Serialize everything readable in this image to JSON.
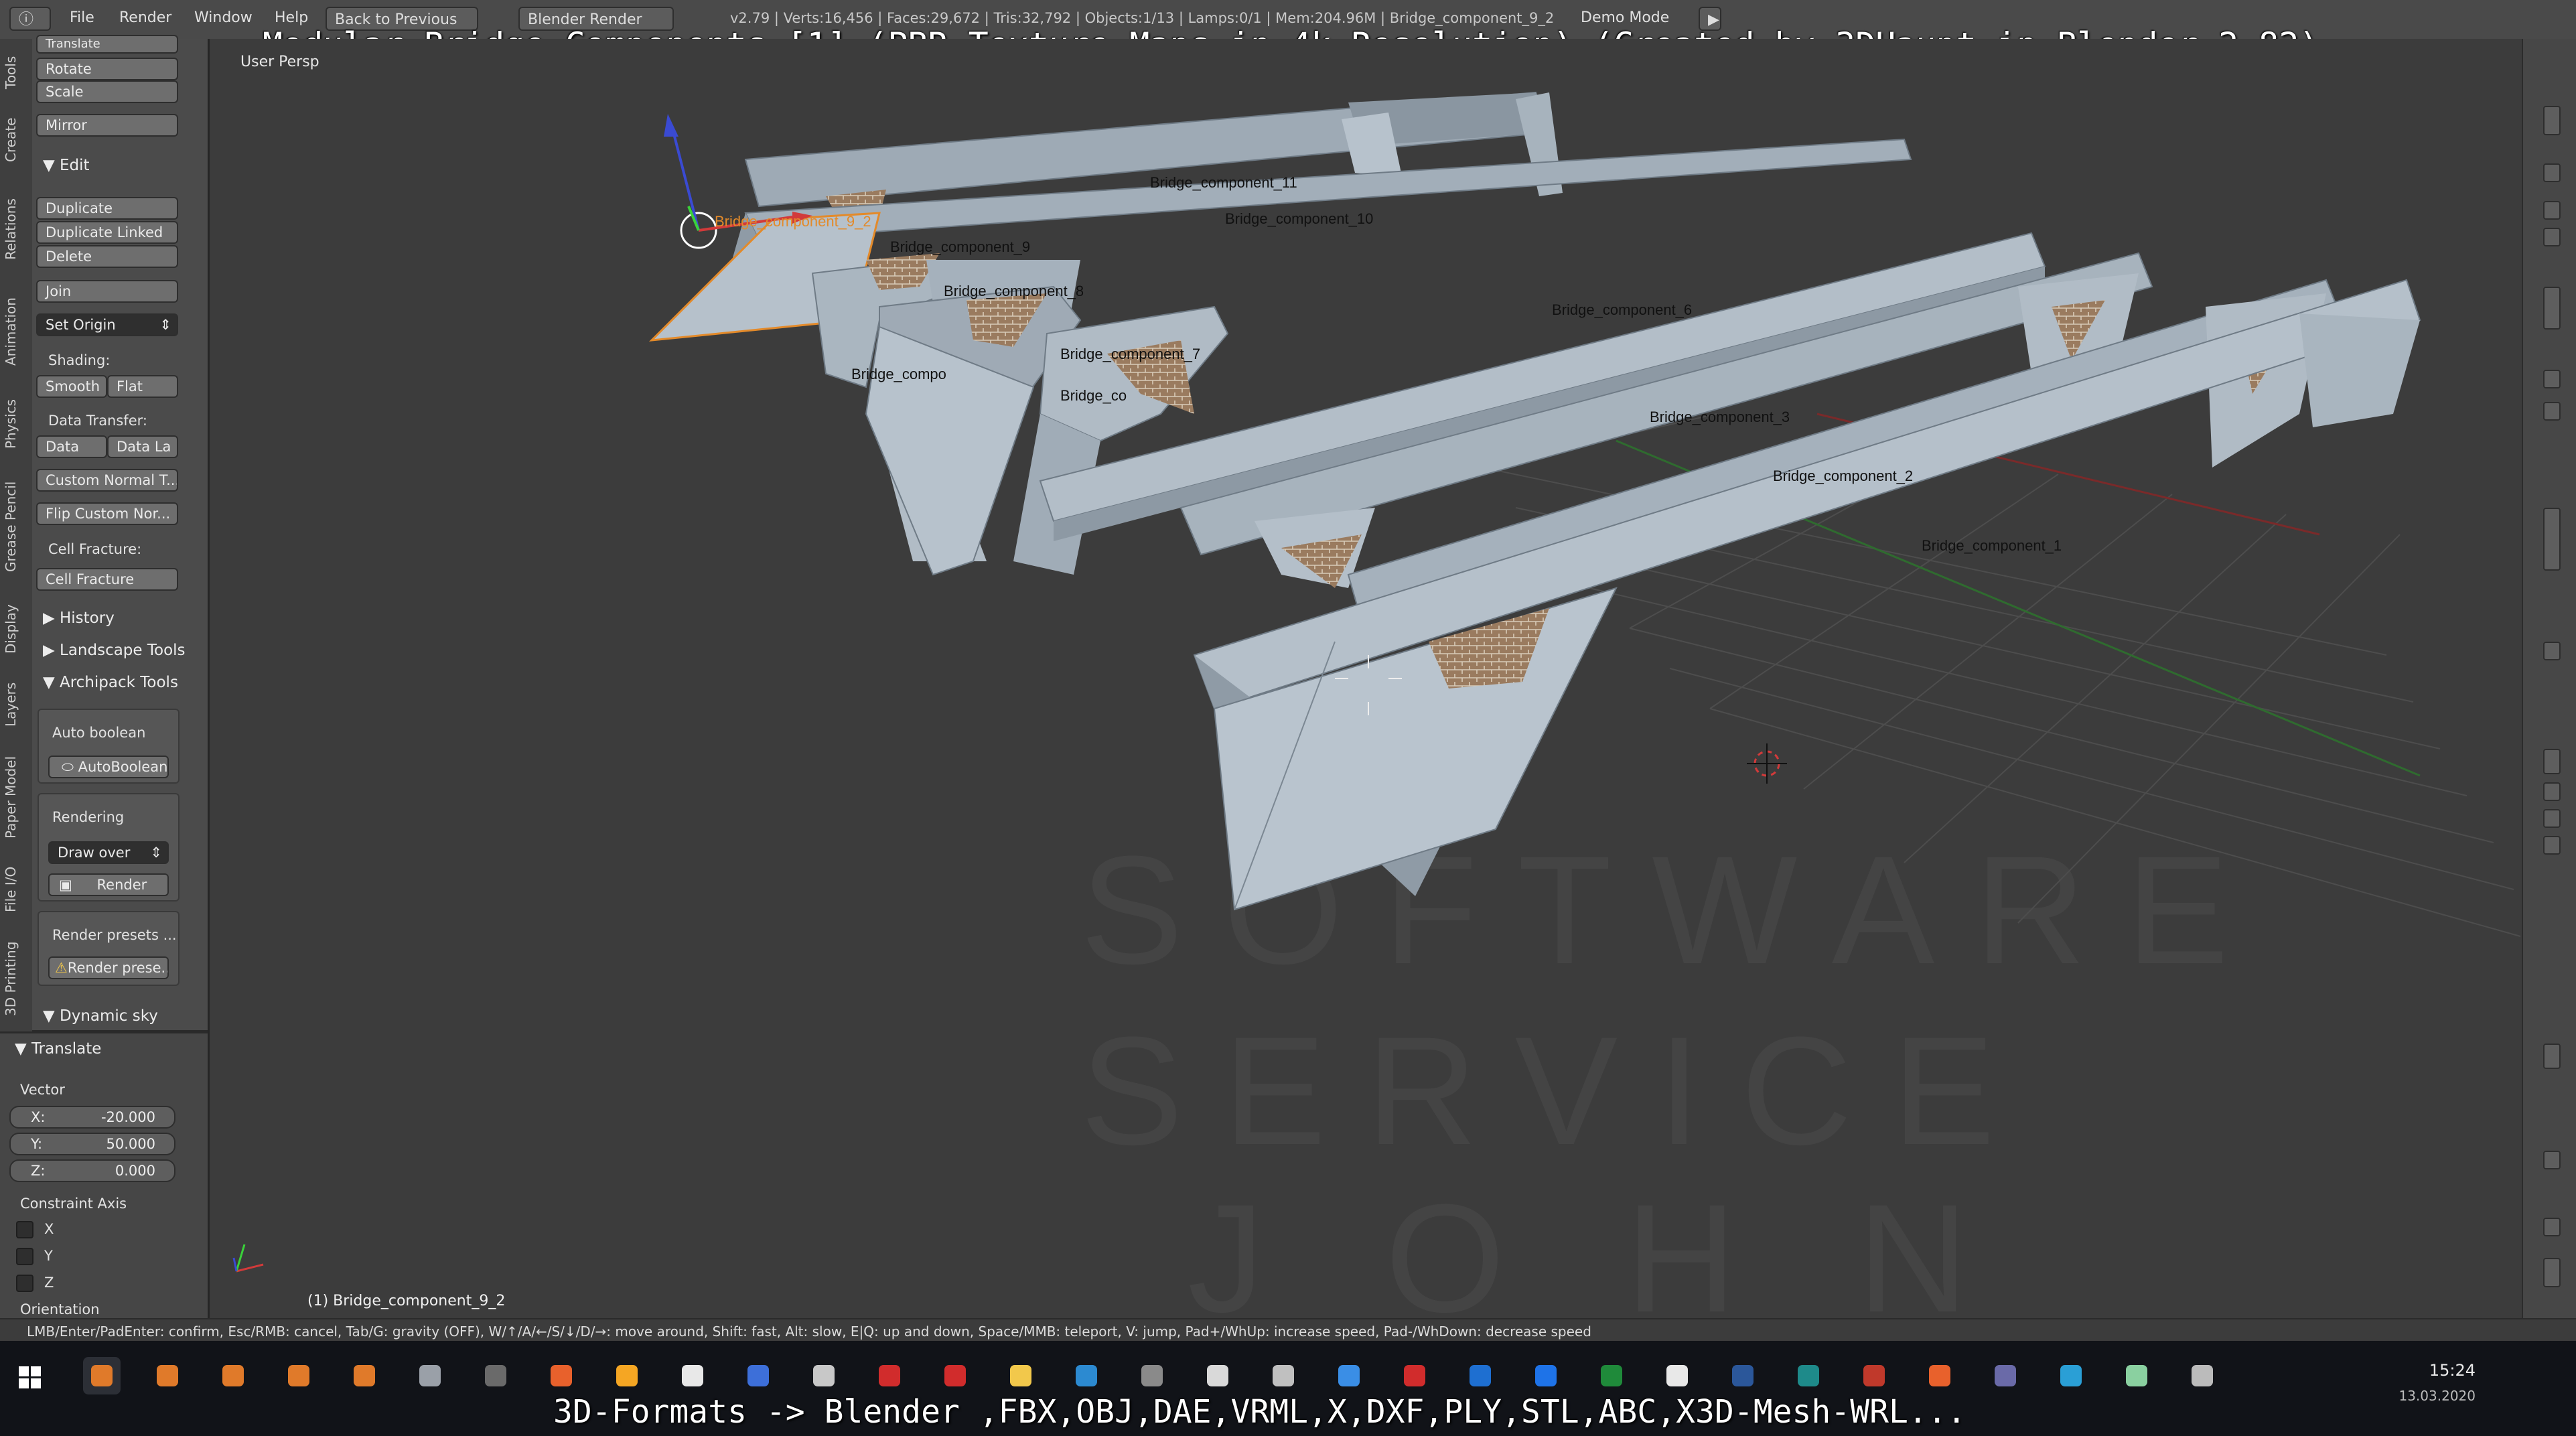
{
  "title_overlay": "Modular Bridge Components [1] (PBR Texture Maps in 4k Resolution) (Created by 3DHaupt in Blender-2.82)",
  "bottom_overlay": "3D-Formats -> Blender ,FBX,OBJ,DAE,VRML,X,DXF,PLY,STL,ABC,X3D-Mesh-WRL...",
  "menu": {
    "items": [
      "File",
      "Render",
      "Window",
      "Help"
    ],
    "back_label": "Back to Previous",
    "engine": "Blender Render",
    "info": "v2.79 | Verts:16,456 | Faces:29,672 | Tris:32,792 | Objects:1/13 | Lamps:0/1 | Mem:204.96M | Bridge_component_9_2",
    "mode": "Demo Mode"
  },
  "vertical_tabs": [
    "Tools",
    "Create",
    "Relations",
    "Animation",
    "Physics",
    "Grease Pencil",
    "Display",
    "Layers",
    "Paper Model",
    "File I/O",
    "3D Printing"
  ],
  "toolshelf": {
    "translate_cut": "Translate",
    "rotate": "Rotate",
    "scale": "Scale",
    "mirror": "Mirror",
    "edit_header": "Edit",
    "duplicate": "Duplicate",
    "duplicate_linked": "Duplicate Linked",
    "delete": "Delete",
    "join": "Join",
    "set_origin": "Set Origin",
    "shading_label": "Shading:",
    "smooth": "Smooth",
    "flat": "Flat",
    "data_transfer_label": "Data Transfer:",
    "data": "Data",
    "data_la": "Data La",
    "custom_normal": "Custom Normal T...",
    "flip_custom": "Flip Custom Nor...",
    "cell_fracture_label": "Cell Fracture:",
    "cell_fracture": "Cell Fracture",
    "history": "History",
    "landscape_tools": "Landscape Tools",
    "archipack_tools": "Archipack Tools",
    "auto_boolean_label": "Auto boolean",
    "autoboolean": "AutoBoolean",
    "rendering_label": "Rendering",
    "draw_over": "Draw over",
    "render": "Render",
    "render_presets_label": "Render presets ...",
    "render_presets_btn": "Render prese...",
    "dynamic_sky": "Dynamic sky"
  },
  "operator": {
    "header": "Translate",
    "vector_label": "Vector",
    "x_label": "X:",
    "x_value": "-20.000",
    "y_label": "Y:",
    "y_value": "50.000",
    "z_label": "Z:",
    "z_value": "0.000",
    "constraint_label": "Constraint Axis",
    "axis_x": "X",
    "axis_y": "Y",
    "axis_z": "Z",
    "orientation_label": "Orientation"
  },
  "viewport": {
    "view_label": "User Persp",
    "active_object": "(1) Bridge_component_9_2",
    "selected_label": "Bridge_component_9_2",
    "object_labels": [
      "Bridge_component_11",
      "Bridge_component_10",
      "Bridge_component_9",
      "Bridge_component_8",
      "Bridge_component_7",
      "Bridge_compo",
      "Bridge_co",
      "Bridge_component_6",
      "Bridge_component_3",
      "Bridge_component_2",
      "Bridge_component_1"
    ],
    "watermark_lines": [
      "SOFTWARE",
      "SERVICE",
      "JOHN"
    ]
  },
  "status": "LMB/Enter/PadEnter: confirm, Esc/RMB: cancel, Tab/G: gravity (OFF), W/↑/A/←/S/↓/D/→: move around, Shift: fast, Alt: slow, E|Q: up and down, Space/MMB: teleport, V: jump, Pad+/WhUp: increase speed, Pad-/WhDown: decrease speed",
  "taskbar": {
    "time": "15:24",
    "date": "13.03.2020",
    "icon_colors": [
      "#e07a2a",
      "#e07a2a",
      "#e07a2a",
      "#e07a2a",
      "#e07a2a",
      "#9aa0a8",
      "#6a6a6a",
      "#e8612c",
      "#f5a623",
      "#e8e8e8",
      "#3d6fd9",
      "#c8c8c8",
      "#d12c2c",
      "#d12c2c",
      "#f2c84b",
      "#2c8ad1",
      "#8a8a8a",
      "#d9d9d9",
      "#c0c0c0",
      "#3a8ee6",
      "#d12c2c",
      "#1e6fd1",
      "#1e73e8",
      "#1f8a3a",
      "#e8e8e8",
      "#2b579a",
      "#1e8a8a",
      "#c0392b",
      "#e8612c",
      "#6a6aa8",
      "#2a9fd6",
      "#8ad0a0",
      "#bbbbbb"
    ]
  }
}
